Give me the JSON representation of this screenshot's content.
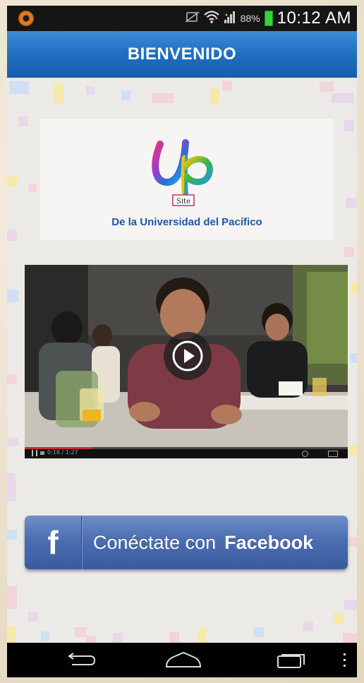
{
  "status_bar": {
    "battery_percent": "88%",
    "time": "10:12 AM",
    "icons": [
      "app-notification-icon",
      "no-sim-icon",
      "wifi-icon",
      "signal-icon",
      "battery-icon"
    ]
  },
  "header": {
    "title": "BIENVENIDO",
    "color": "#1f6ec1"
  },
  "logo": {
    "mark": "Up",
    "badge": "Site",
    "caption": "De la Universidad del Pacífico"
  },
  "video": {
    "time": "0:18 / 1:27",
    "progress": 0.21,
    "icons": [
      "play-icon",
      "pause-icon",
      "volume-icon",
      "settings-icon",
      "fullscreen-icon"
    ]
  },
  "facebook_button": {
    "label_prefix": "Conéctate con",
    "label_brand": "Facebook",
    "icon": "facebook-f-icon",
    "color": "#4c6eb1"
  },
  "nav_bar": {
    "buttons": [
      "back-icon",
      "home-icon",
      "recent-apps-icon",
      "menu-icon"
    ]
  }
}
